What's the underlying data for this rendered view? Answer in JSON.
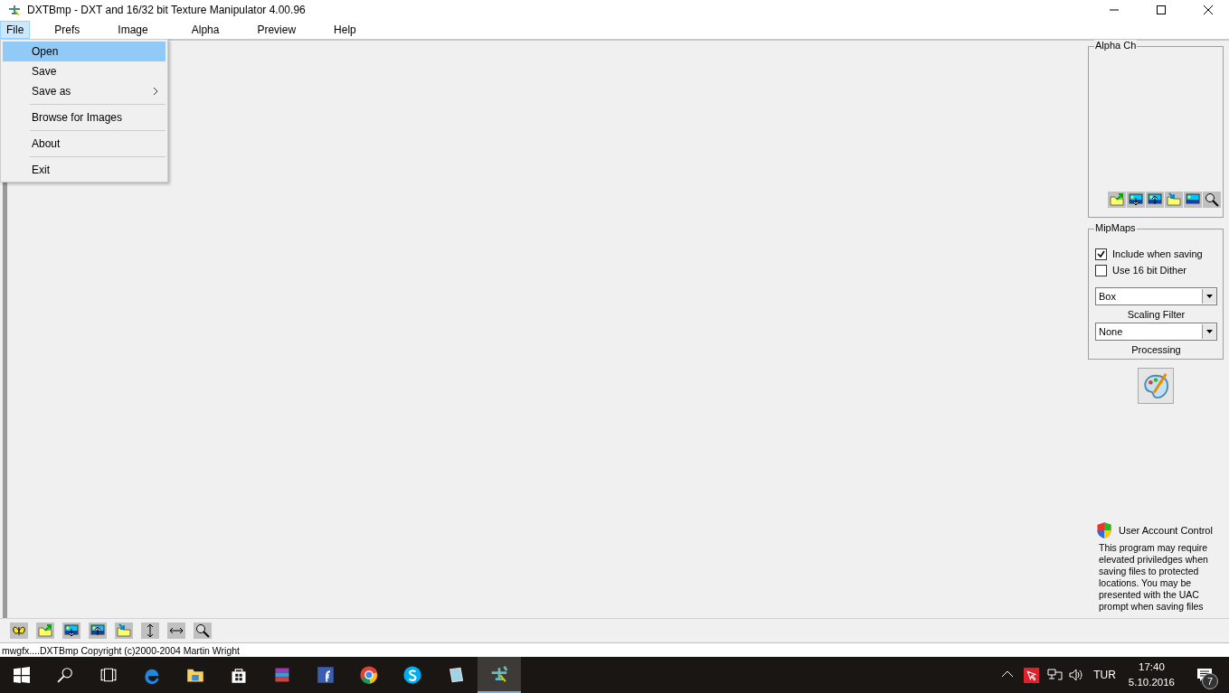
{
  "window": {
    "title": "DXTBmp - DXT and 16/32 bit Texture Manipulator  4.00.96"
  },
  "menu": [
    {
      "label": "File",
      "selected": true
    },
    {
      "label": "Prefs",
      "selected": false
    },
    {
      "label": "Image",
      "selected": false
    },
    {
      "label": "Alpha",
      "selected": false
    },
    {
      "label": "Preview",
      "selected": false
    },
    {
      "label": "Help",
      "selected": false
    }
  ],
  "file_menu": {
    "groups": [
      [
        {
          "label": "Open",
          "selected": true,
          "submenu": false
        },
        {
          "label": "Save",
          "selected": false,
          "submenu": false
        },
        {
          "label": "Save as",
          "selected": false,
          "submenu": true
        }
      ],
      [
        {
          "label": "Browse for Images",
          "selected": false,
          "submenu": false
        }
      ],
      [
        {
          "label": "About",
          "selected": false,
          "submenu": false
        }
      ],
      [
        {
          "label": "Exit",
          "selected": false,
          "submenu": false
        }
      ]
    ]
  },
  "alpha_group": {
    "title": "Alpha Ch"
  },
  "mipmaps": {
    "title": "MipMaps",
    "options": [
      {
        "label": "Include when saving",
        "checked": true
      },
      {
        "label": "Use 16 bit Dither",
        "checked": false
      }
    ],
    "selects": [
      {
        "value": "Box",
        "caption": "Scaling Filter"
      },
      {
        "value": "None",
        "caption": "Processing"
      }
    ]
  },
  "uac": {
    "title": "User Account Control",
    "text": "This program may require elevated priviledges when saving files to protected locations. You may be presented with the UAC prompt when saving files"
  },
  "status_bar": "mwgfx....DXTBmp Copyright (c)2000-2004 Martin Wright",
  "taskbar": {
    "apps": [
      {
        "kind": "edge",
        "selected": false
      },
      {
        "kind": "explorer",
        "selected": false
      },
      {
        "kind": "store",
        "selected": false
      },
      {
        "kind": "winrar",
        "selected": false
      },
      {
        "kind": "facebook",
        "selected": false
      },
      {
        "kind": "chrome",
        "selected": false
      },
      {
        "kind": "skype",
        "selected": false
      },
      {
        "kind": "note",
        "selected": false
      },
      {
        "kind": "dxtbmp",
        "selected": true
      }
    ],
    "language": "TUR",
    "time": "17:40",
    "date": "5.10.2016",
    "notifications": "7"
  }
}
